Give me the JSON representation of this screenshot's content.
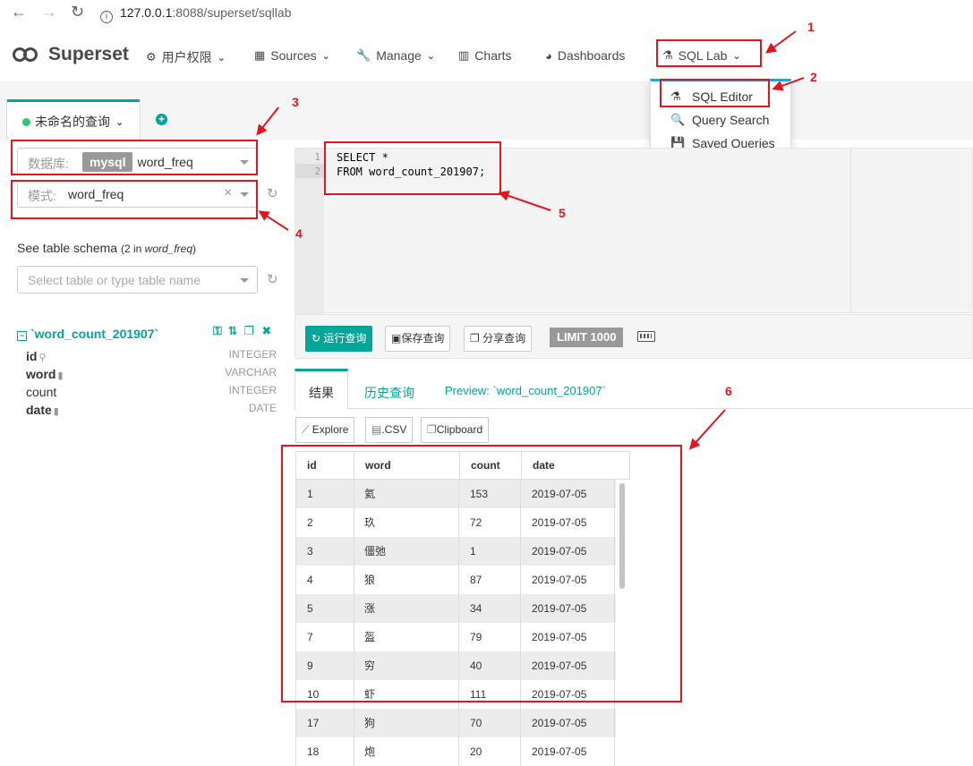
{
  "browser": {
    "url_host": "127.0.0.1",
    "url_rest": ":8088/superset/sqllab"
  },
  "navbar": {
    "brand": "Superset",
    "items": [
      {
        "label": "用户权限",
        "icon": "users-cog-icon"
      },
      {
        "label": "Sources",
        "icon": "table-icon"
      },
      {
        "label": "Manage",
        "icon": "wrench-icon"
      },
      {
        "label": "Charts",
        "icon": "bar-chart-icon"
      },
      {
        "label": "Dashboards",
        "icon": "dashboard-icon"
      },
      {
        "label": "SQL Lab",
        "icon": "flask-icon"
      }
    ]
  },
  "dropdown": {
    "items": [
      {
        "label": "SQL Editor",
        "icon": "flask-icon"
      },
      {
        "label": "Query Search",
        "icon": "search-icon"
      },
      {
        "label": "Saved Queries",
        "icon": "save-icon"
      }
    ]
  },
  "query_tab": {
    "label": "未命名的查询"
  },
  "left": {
    "database_label": "数据库:",
    "database_tag": "mysql",
    "database_value": "word_freq",
    "schema_label": "模式:",
    "schema_value": "word_freq",
    "schema_clear": "×",
    "schema_title": "See table schema",
    "schema_count": "(2 in ",
    "schema_count_db": "word_freq",
    "schema_count_end": ")",
    "table_placeholder": "Select table or type table name",
    "table_name": "`word_count_201907`",
    "columns": [
      {
        "name": "id",
        "type": "INTEGER",
        "bold": true,
        "icon": "key-icon"
      },
      {
        "name": "word",
        "type": "VARCHAR",
        "bold": true,
        "icon": "bookmark-icon"
      },
      {
        "name": "count",
        "type": "INTEGER",
        "bold": false,
        "icon": ""
      },
      {
        "name": "date",
        "type": "DATE",
        "bold": true,
        "icon": "bookmark-icon"
      }
    ]
  },
  "editor": {
    "line_numbers": [
      "1",
      "2"
    ],
    "line1": "SELECT *",
    "line2": "FROM word_count_201907;"
  },
  "toolbar": {
    "run": "运行查询",
    "save": "保存查询",
    "share": "分享查询",
    "limit": "LIMIT 1000"
  },
  "results": {
    "tabs": [
      "结果",
      "历史查询",
      "Preview: `word_count_201907`"
    ],
    "buttons": [
      "Explore",
      ".CSV",
      "Clipboard"
    ],
    "columns": [
      "id",
      "word",
      "count",
      "date"
    ],
    "rows": [
      [
        "1",
        "氦",
        "153",
        "2019-07-05"
      ],
      [
        "2",
        "玖",
        "72",
        "2019-07-05"
      ],
      [
        "3",
        "僵弛",
        "1",
        "2019-07-05"
      ],
      [
        "4",
        "狼",
        "87",
        "2019-07-05"
      ],
      [
        "5",
        "涨",
        "34",
        "2019-07-05"
      ],
      [
        "7",
        "盔",
        "79",
        "2019-07-05"
      ],
      [
        "9",
        "穷",
        "40",
        "2019-07-05"
      ],
      [
        "10",
        "虾",
        "111",
        "2019-07-05"
      ],
      [
        "17",
        "狗",
        "70",
        "2019-07-05"
      ],
      [
        "18",
        "炮",
        "20",
        "2019-07-05"
      ]
    ]
  },
  "annotations": [
    "1",
    "2",
    "3",
    "4",
    "5",
    "6"
  ],
  "colors": {
    "accent": "#00a699",
    "annotation": "#e0171f",
    "tag": "#999999"
  }
}
